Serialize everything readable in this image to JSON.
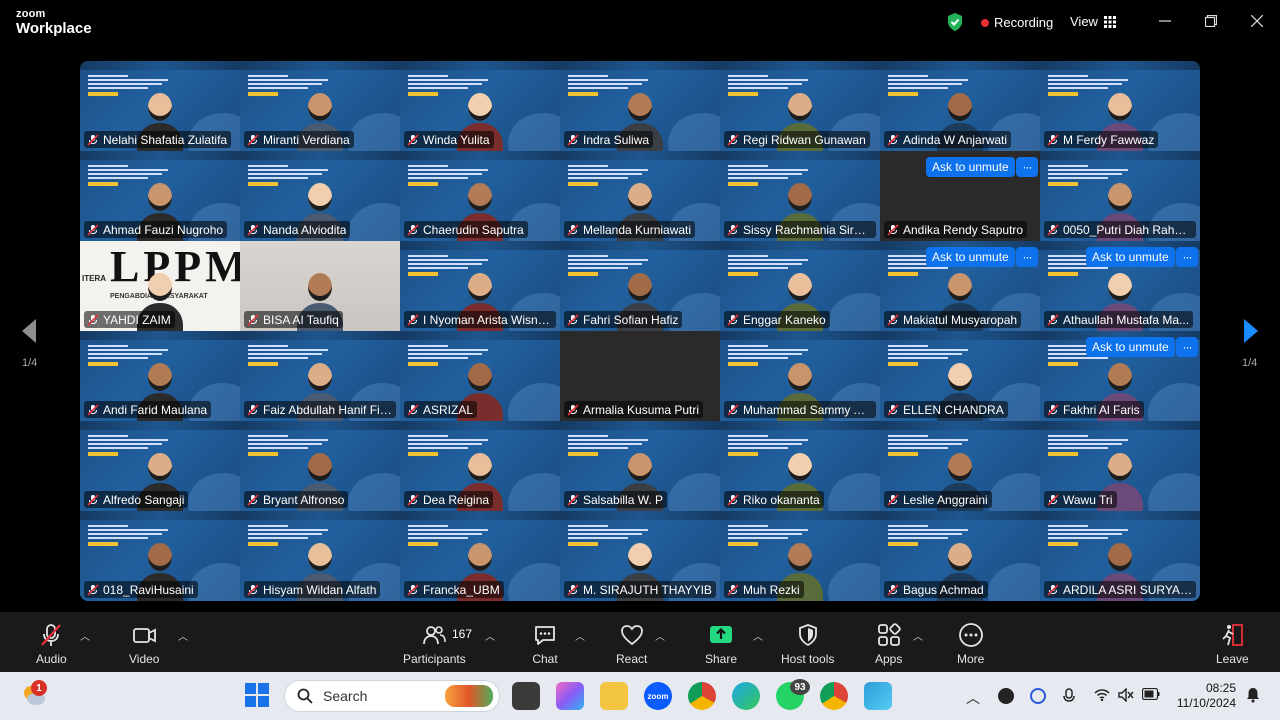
{
  "app": {
    "brand_top": "zoom",
    "brand_bottom": "Workplace"
  },
  "topbar": {
    "recording_label": "Recording",
    "view_label": "View"
  },
  "gallery": {
    "page_left": "1/4",
    "page_right": "1/4",
    "ask_to_unmute_label": "Ask to unmute",
    "more_label": "···",
    "tiles": [
      {
        "name": "Nelahi Shafatia Zulatifa",
        "bg": "slide"
      },
      {
        "name": "Miranti Verdiana",
        "bg": "slide"
      },
      {
        "name": "Winda Yulita",
        "bg": "slide"
      },
      {
        "name": "Indra Suliwa",
        "bg": "slide"
      },
      {
        "name": "Regi Ridwan Gunawan",
        "bg": "slide"
      },
      {
        "name": "Adinda W Anjarwati",
        "bg": "slide"
      },
      {
        "name": "M Ferdy Fawwaz",
        "bg": "slide"
      },
      {
        "name": "Ahmad Fauzi Nugroho",
        "bg": "slide"
      },
      {
        "name": "Nanda Alviodita",
        "bg": "slide"
      },
      {
        "name": "Chaerudin Saputra",
        "bg": "slide"
      },
      {
        "name": "Mellanda Kurniawati",
        "bg": "slide"
      },
      {
        "name": "Sissy Rachmania Siregar",
        "bg": "slide"
      },
      {
        "name": "Andika Rendy Saputro",
        "bg": "dark",
        "ask": true
      },
      {
        "name": "0050_Putri Diah Rahm...",
        "bg": "slide"
      },
      {
        "name": "YAHDI ZAIM",
        "bg": "lppm"
      },
      {
        "name": "BISA AI Taufiq",
        "bg": "room"
      },
      {
        "name": "I Nyoman Arista Wisna...",
        "bg": "slide"
      },
      {
        "name": "Fahri Sofian Hafiz",
        "bg": "slide"
      },
      {
        "name": "Enggar Kaneko",
        "bg": "slide"
      },
      {
        "name": "Makiatul Musyaropah",
        "bg": "slide",
        "ask": true
      },
      {
        "name": "Athaullah Mustafa Ma...",
        "bg": "slide",
        "ask": true
      },
      {
        "name": "Andi Farid Maulana",
        "bg": "slide"
      },
      {
        "name": "Faiz Abdullah Hanif Fir...",
        "bg": "slide"
      },
      {
        "name": "ASRIZAL",
        "bg": "slide"
      },
      {
        "name": "Armalia Kusuma Putri",
        "bg": "dark"
      },
      {
        "name": "Muhammad Sammy Ai...",
        "bg": "slide"
      },
      {
        "name": "ELLEN CHANDRA",
        "bg": "slide"
      },
      {
        "name": "Fakhri Al Faris",
        "bg": "slide",
        "ask": true
      },
      {
        "name": "Alfredo Sangaji",
        "bg": "slide"
      },
      {
        "name": "Bryant Alfronso",
        "bg": "slide"
      },
      {
        "name": "Dea Reigina",
        "bg": "slide"
      },
      {
        "name": "Salsabilla W. P",
        "bg": "slide"
      },
      {
        "name": "Riko okananta",
        "bg": "slide"
      },
      {
        "name": "Leslie Anggraini",
        "bg": "slide",
        "active": true
      },
      {
        "name": "Wawu Tri",
        "bg": "slide"
      },
      {
        "name": "018_RaviHusaini",
        "bg": "slide"
      },
      {
        "name": "Hisyam Wildan Alfath",
        "bg": "slide"
      },
      {
        "name": "Francka_UBM",
        "bg": "slide"
      },
      {
        "name": "M. SIRAJUTH THAYYIB",
        "bg": "slide"
      },
      {
        "name": "Muh Rezki",
        "bg": "slide"
      },
      {
        "name": "Bagus Achmad",
        "bg": "slide"
      },
      {
        "name": "ARDILA ASRI SURYAN...",
        "bg": "slide"
      }
    ]
  },
  "lppm_slide": {
    "title": "LPPM",
    "subtitle": "PENGABDIAN MASYARAKAT",
    "itera": "ITERA"
  },
  "toolbar": {
    "audio": "Audio",
    "video": "Video",
    "participants": "Participants",
    "participants_count": "167",
    "chat": "Chat",
    "react": "React",
    "share": "Share",
    "host_tools": "Host tools",
    "apps": "Apps",
    "more": "More",
    "leave": "Leave"
  },
  "taskbar": {
    "search_placeholder": "Search",
    "weather_badge": "1",
    "whatsapp_badge": "93",
    "time": "08:25",
    "date": "11/10/2024"
  },
  "colors": {
    "toolbar_bg": "#1a1a1a",
    "accent_blue": "#0e72ed",
    "active_speaker": "#23d980",
    "mute_red": "#e8303a",
    "share_green": "#23d980"
  }
}
